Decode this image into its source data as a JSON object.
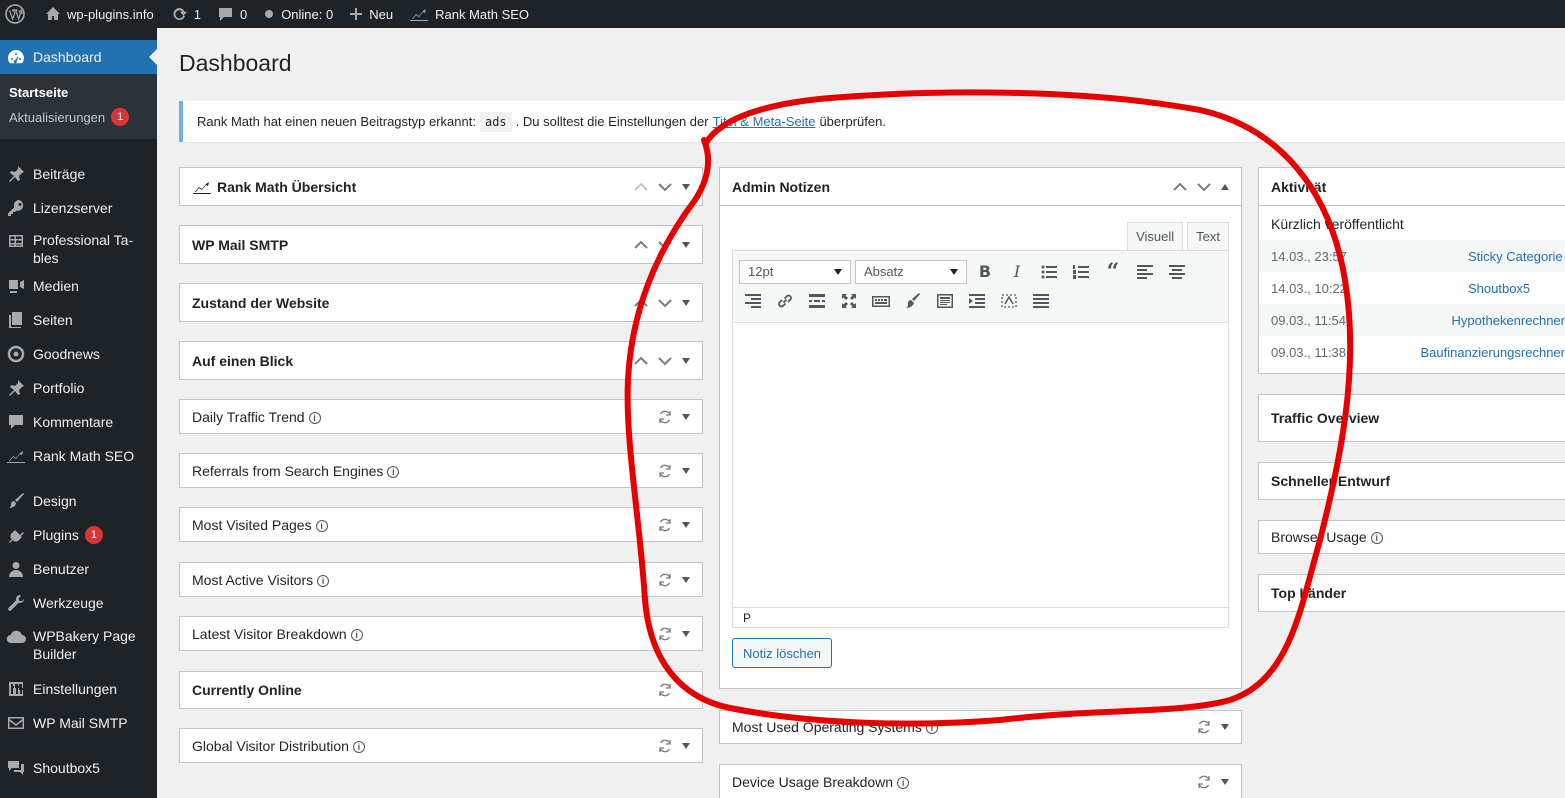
{
  "adminbar": {
    "site": "wp-plugins.info",
    "updates": "1",
    "comments": "0",
    "online": "Online: 0",
    "new": "Neu",
    "rankmath": "Rank Math SEO"
  },
  "sidebar": {
    "dashboard": "Dashboard",
    "sub_home": "Startseite",
    "sub_updates": "Aktualisierungen",
    "sub_updates_badge": "1",
    "items": [
      "Beiträge",
      "Lizenzserver",
      "Professional Ta-bles",
      "Medien",
      "Seiten",
      "Goodnews",
      "Portfolio",
      "Kommentare",
      "Rank Math SEO",
      "Design",
      "Plugins",
      "Benutzer",
      "Werkzeuge",
      "WPBakery Page Builder",
      "Einstellungen",
      "WP Mail SMTP",
      "Shoutbox5"
    ],
    "plugins_badge": "1"
  },
  "page": {
    "title": "Dashboard"
  },
  "notice": {
    "text_before": "Rank Math hat einen neuen Beitragstyp erkannt:",
    "code": "ads",
    "text_mid": ". Du solltest die Einstellungen der",
    "link": "Titel & Meta-Seite",
    "text_after": "überprüfen."
  },
  "left_boxes": [
    "Rank Math Übersicht",
    "WP Mail SMTP",
    "Zustand der Website",
    "Auf einen Blick",
    "Daily Traffic Trend",
    "Referrals from Search Engines",
    "Most Visited Pages",
    "Most Active Visitors",
    "Latest Visitor Breakdown",
    "Currently Online",
    "Global Visitor Distribution"
  ],
  "notes": {
    "title": "Admin Notizen",
    "tab_visual": "Visuell",
    "tab_text": "Text",
    "font_size": "12pt",
    "format": "Absatz",
    "status_path": "P",
    "delete_button": "Notiz löschen"
  },
  "mid_boxes": [
    "Most Used Operating Systems",
    "Device Usage Breakdown"
  ],
  "activity": {
    "title": "Aktivität",
    "subtitle": "Kürzlich veröffentlicht",
    "rows": [
      {
        "date": "14.03., 23:57",
        "title": "Sticky Categorie"
      },
      {
        "date": "14.03., 10:22",
        "title": "Shoutbox5"
      },
      {
        "date": "09.03., 11:54",
        "title": "Hypothekenrechner"
      },
      {
        "date": "09.03., 11:38",
        "title": "Baufinanzierungsrechner"
      }
    ]
  },
  "right_boxes": [
    "Traffic Overview",
    "Schneller Entwurf",
    "Browser Usage",
    "Top Länder"
  ],
  "colors": {
    "admin_bar": "#1d2327",
    "accent": "#2271b1",
    "badge": "#d63638",
    "annotation": "#e60000"
  }
}
